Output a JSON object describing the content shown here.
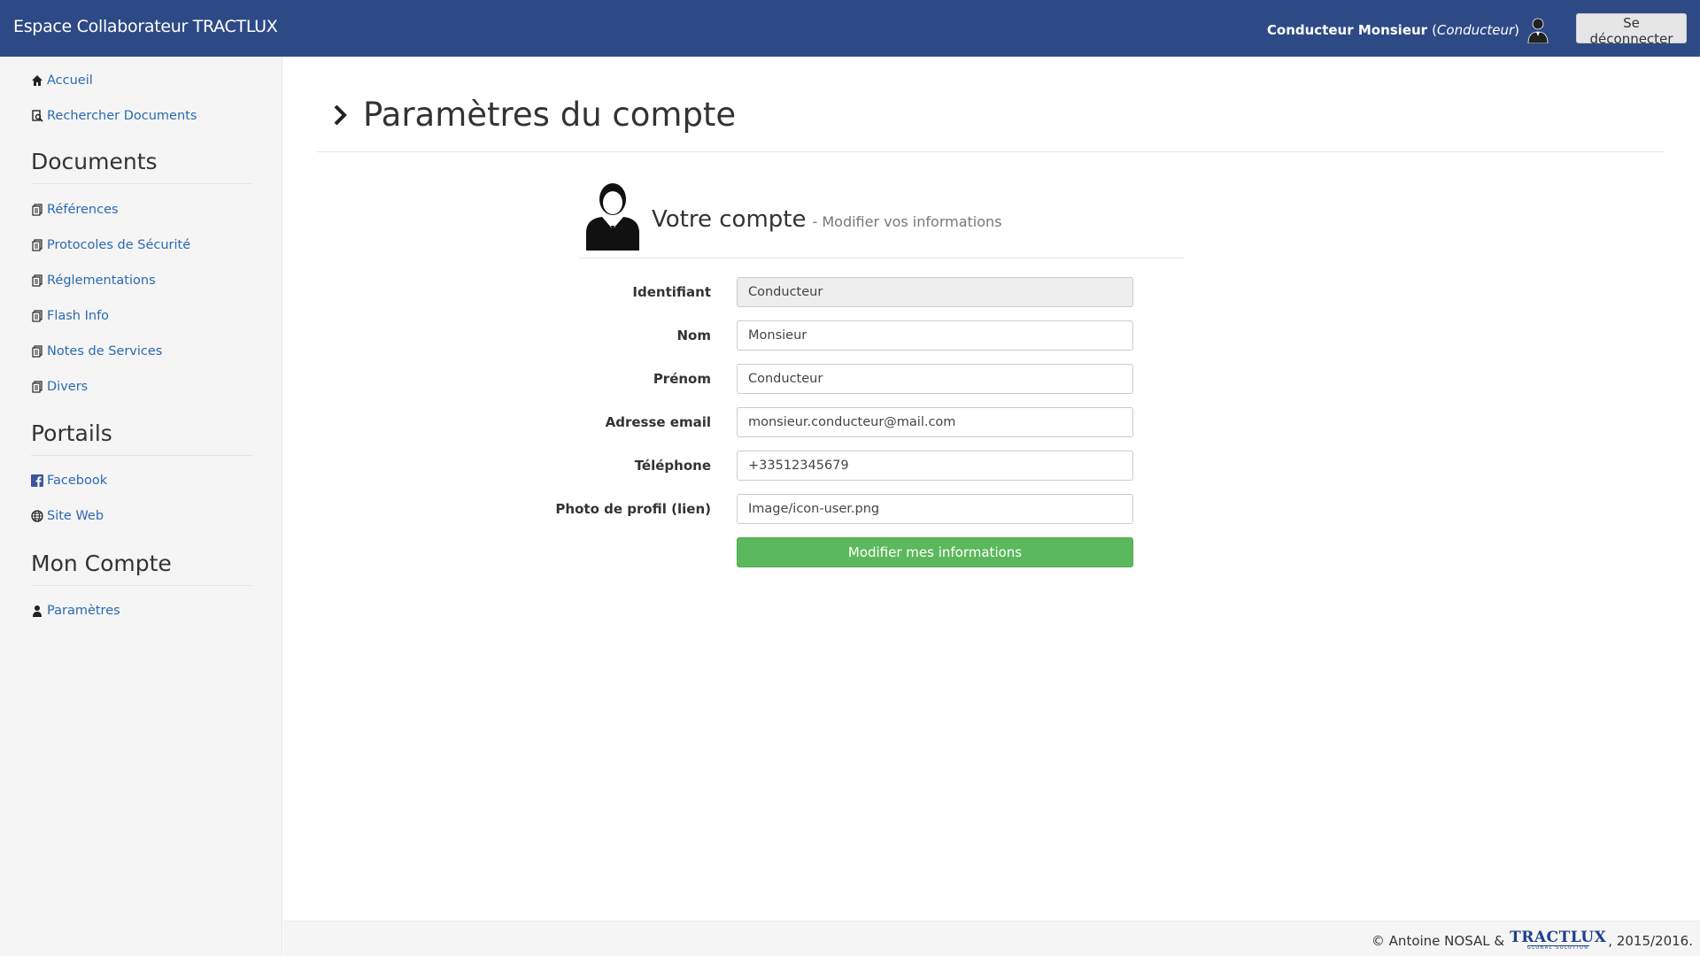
{
  "navbar": {
    "brand": "Espace Collaborateur TRACTLUX",
    "user_name": "Conducteur Monsieur",
    "user_role_open": "(",
    "user_role": "Conducteur",
    "user_role_close": ")",
    "logout_label": "Se déconnecter",
    "user_icon": "user-silhouette-icon"
  },
  "sidebar": {
    "top_links": [
      {
        "label": "Accueil",
        "icon": "home-icon"
      },
      {
        "label": "Rechercher Documents",
        "icon": "search-document-icon"
      }
    ],
    "sections": [
      {
        "title": "Documents",
        "items": [
          {
            "label": "Références",
            "icon": "document-icon"
          },
          {
            "label": "Protocoles de Sécurité",
            "icon": "document-icon"
          },
          {
            "label": "Réglementations",
            "icon": "document-icon"
          },
          {
            "label": "Flash Info",
            "icon": "document-icon"
          },
          {
            "label": "Notes de Services",
            "icon": "document-icon"
          },
          {
            "label": "Divers",
            "icon": "document-icon"
          }
        ]
      },
      {
        "title": "Portails",
        "items": [
          {
            "label": "Facebook",
            "icon": "facebook-icon"
          },
          {
            "label": "Site Web",
            "icon": "globe-icon"
          }
        ]
      },
      {
        "title": "Mon Compte",
        "items": [
          {
            "label": "Paramètres",
            "icon": "user-icon"
          }
        ]
      }
    ]
  },
  "main": {
    "page_title": "Paramètres du compte",
    "account_heading": "Votre compte",
    "account_subheading": "- Modifier vos informations",
    "form": {
      "fields": [
        {
          "label": "Identifiant",
          "value": "Conducteur",
          "readonly": true
        },
        {
          "label": "Nom",
          "value": "Monsieur"
        },
        {
          "label": "Prénom",
          "value": "Conducteur"
        },
        {
          "label": "Adresse email",
          "value": "monsieur.conducteur@mail.com"
        },
        {
          "label": "Téléphone",
          "value": "+33512345679"
        },
        {
          "label": "Photo de profil (lien)",
          "value": "Image/icon-user.png"
        }
      ],
      "submit_label": "Modifier mes informations"
    }
  },
  "footer": {
    "copyright": "© Antoine NOSAL &",
    "logo_text": "TRACTLUX",
    "logo_sub": "GLOBAL SOLUTION",
    "year": ", 2015/2016."
  },
  "colors": {
    "navbar": "#2e4a86",
    "link": "#2a6ab1",
    "success": "#5cb85c"
  }
}
